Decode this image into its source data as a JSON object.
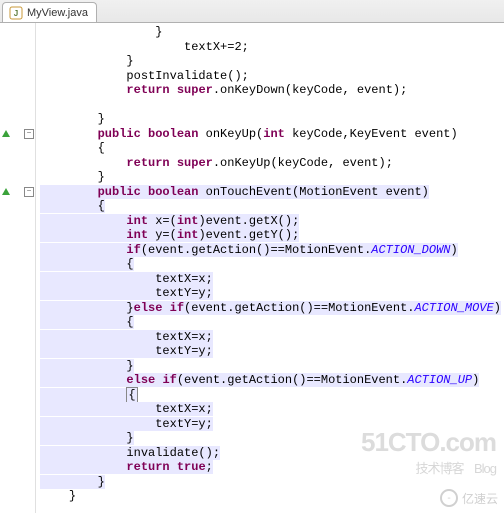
{
  "tab": {
    "title": "MyView.java",
    "icon": "java-file-icon"
  },
  "code": {
    "lines": [
      {
        "indent": 4,
        "tokens": [
          {
            "t": "}",
            "c": ""
          }
        ]
      },
      {
        "indent": 5,
        "tokens": [
          {
            "t": "textX+=2;",
            "c": ""
          }
        ]
      },
      {
        "indent": 3,
        "tokens": [
          {
            "t": "}",
            "c": ""
          }
        ]
      },
      {
        "indent": 3,
        "tokens": [
          {
            "t": "postInvalidate();",
            "c": ""
          }
        ]
      },
      {
        "indent": 3,
        "tokens": [
          {
            "t": "return ",
            "c": "kw"
          },
          {
            "t": "super",
            "c": "kw"
          },
          {
            "t": ".onKeyDown(keyCode, event);",
            "c": ""
          }
        ]
      },
      {
        "indent": 0,
        "tokens": []
      },
      {
        "indent": 2,
        "tokens": [
          {
            "t": "}",
            "c": ""
          }
        ]
      },
      {
        "indent": 2,
        "tokens": [
          {
            "t": "public ",
            "c": "kw"
          },
          {
            "t": "boolean ",
            "c": "kw"
          },
          {
            "t": "onKeyUp(",
            "c": ""
          },
          {
            "t": "int ",
            "c": "kw"
          },
          {
            "t": "keyCode,KeyEvent event)",
            "c": ""
          }
        ],
        "marker": "override"
      },
      {
        "indent": 2,
        "tokens": [
          {
            "t": "{",
            "c": ""
          }
        ]
      },
      {
        "indent": 3,
        "tokens": [
          {
            "t": "return ",
            "c": "kw"
          },
          {
            "t": "super",
            "c": "kw"
          },
          {
            "t": ".onKeyUp(keyCode, event);",
            "c": ""
          }
        ]
      },
      {
        "indent": 2,
        "tokens": [
          {
            "t": "}",
            "c": ""
          }
        ]
      },
      {
        "indent": 2,
        "tokens": [
          {
            "t": "public ",
            "c": "kw"
          },
          {
            "t": "boolean ",
            "c": "kw"
          },
          {
            "t": "onTouchEvent(MotionEvent event)",
            "c": ""
          }
        ],
        "marker": "override",
        "hl": true
      },
      {
        "indent": 2,
        "tokens": [
          {
            "t": "{",
            "c": ""
          }
        ],
        "hl": true
      },
      {
        "indent": 3,
        "tokens": [
          {
            "t": "int ",
            "c": "kw"
          },
          {
            "t": "x=(",
            "c": ""
          },
          {
            "t": "int",
            "c": "kw"
          },
          {
            "t": ")event.getX();",
            "c": ""
          }
        ],
        "hl": true
      },
      {
        "indent": 3,
        "tokens": [
          {
            "t": "int ",
            "c": "kw"
          },
          {
            "t": "y=(",
            "c": ""
          },
          {
            "t": "int",
            "c": "kw"
          },
          {
            "t": ")event.getY();",
            "c": ""
          }
        ],
        "hl": true
      },
      {
        "indent": 3,
        "tokens": [
          {
            "t": "if",
            "c": "kw"
          },
          {
            "t": "(event.getAction()==MotionEvent.",
            "c": ""
          },
          {
            "t": "ACTION_DOWN",
            "c": "const"
          },
          {
            "t": ")",
            "c": ""
          }
        ],
        "hl": true
      },
      {
        "indent": 3,
        "tokens": [
          {
            "t": "{",
            "c": ""
          }
        ],
        "hl": true
      },
      {
        "indent": 4,
        "tokens": [
          {
            "t": "textX=x;",
            "c": ""
          }
        ],
        "hl": true
      },
      {
        "indent": 4,
        "tokens": [
          {
            "t": "textY=y;",
            "c": ""
          }
        ],
        "hl": true
      },
      {
        "indent": 3,
        "tokens": [
          {
            "t": "}",
            "c": ""
          },
          {
            "t": "else ",
            "c": "kw"
          },
          {
            "t": "if",
            "c": "kw"
          },
          {
            "t": "(event.getAction()==MotionEvent.",
            "c": ""
          },
          {
            "t": "ACTION_MOVE",
            "c": "const"
          },
          {
            "t": ")",
            "c": ""
          }
        ],
        "hl": true
      },
      {
        "indent": 3,
        "tokens": [
          {
            "t": "{",
            "c": ""
          }
        ],
        "hl": true
      },
      {
        "indent": 4,
        "tokens": [
          {
            "t": "textX=x;",
            "c": ""
          }
        ],
        "hl": true
      },
      {
        "indent": 4,
        "tokens": [
          {
            "t": "textY=y;",
            "c": ""
          }
        ],
        "hl": true
      },
      {
        "indent": 3,
        "tokens": [
          {
            "t": "}",
            "c": ""
          }
        ],
        "hl": true
      },
      {
        "indent": 3,
        "tokens": [
          {
            "t": "else ",
            "c": "kw"
          },
          {
            "t": "if",
            "c": "kw"
          },
          {
            "t": "(event.getAction()==MotionEvent.",
            "c": ""
          },
          {
            "t": "ACTION_UP",
            "c": "const"
          },
          {
            "t": ")",
            "c": ""
          }
        ],
        "hl": true
      },
      {
        "indent": 3,
        "tokens": [
          {
            "t": "{",
            "c": ""
          }
        ],
        "hl": true,
        "cursorBox": true
      },
      {
        "indent": 4,
        "tokens": [
          {
            "t": "textX=x;",
            "c": ""
          }
        ],
        "hl": true
      },
      {
        "indent": 4,
        "tokens": [
          {
            "t": "textY=y;",
            "c": ""
          }
        ],
        "hl": true
      },
      {
        "indent": 3,
        "tokens": [
          {
            "t": "}",
            "c": ""
          }
        ],
        "hl": true
      },
      {
        "indent": 3,
        "tokens": [
          {
            "t": "invalidate();",
            "c": ""
          }
        ],
        "hl": true
      },
      {
        "indent": 3,
        "tokens": [
          {
            "t": "return ",
            "c": "kw"
          },
          {
            "t": "true",
            "c": "kw"
          },
          {
            "t": ";",
            "c": ""
          }
        ],
        "hl": true
      },
      {
        "indent": 2,
        "tokens": [
          {
            "t": "}",
            "c": ""
          }
        ],
        "hl": true
      },
      {
        "indent": 1,
        "tokens": [
          {
            "t": "}",
            "c": ""
          }
        ]
      }
    ]
  },
  "watermarks": {
    "w1_main": "51CTO.com",
    "w1_sub_left": "技术博客",
    "w1_sub_right": "Blog",
    "w2_logo_char": "-",
    "w2_text": "亿速云"
  },
  "colors": {
    "keyword": "#7f0055",
    "constant": "#2a00ff",
    "highlight": "#e8e8ff"
  }
}
